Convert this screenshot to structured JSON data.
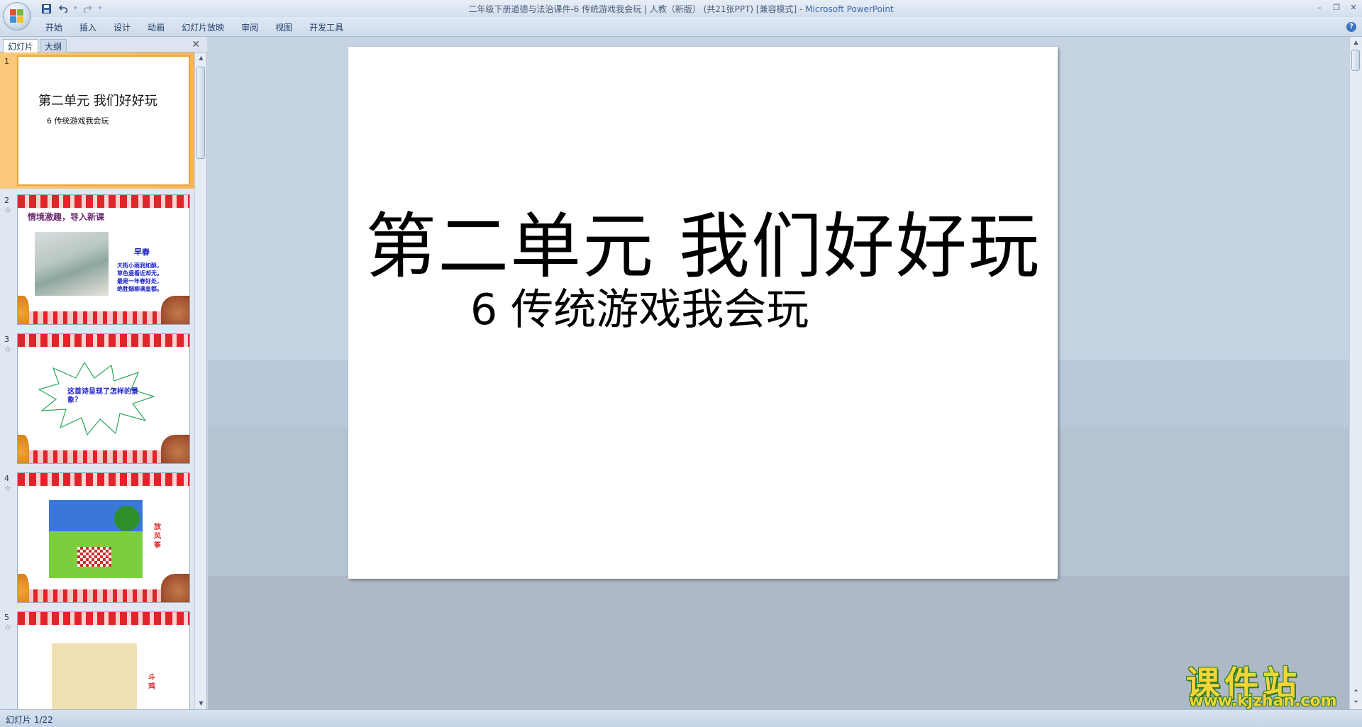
{
  "window": {
    "title_prefix": "二年级下册道德与法治课件-6  传统游戏我会玩 | 人教（新版） (共21张PPT) [兼容模式] - ",
    "title_app": "Microsoft PowerPoint",
    "controls": {
      "minimize": "–",
      "restore": "❐",
      "close": "✕"
    }
  },
  "qat": {
    "save_icon": "save-icon",
    "undo_icon": "undo-icon",
    "redo_icon": "redo-icon",
    "customize_icon": "customize-icon"
  },
  "ribbon": {
    "tabs": [
      {
        "label": "开始"
      },
      {
        "label": "插入"
      },
      {
        "label": "设计"
      },
      {
        "label": "动画"
      },
      {
        "label": "幻灯片放映"
      },
      {
        "label": "审阅"
      },
      {
        "label": "视图"
      },
      {
        "label": "开发工具"
      }
    ],
    "help": "?"
  },
  "left_panel": {
    "tabs": [
      {
        "label": "幻灯片"
      },
      {
        "label": "大纲"
      }
    ],
    "close": "✕",
    "slides": [
      {
        "num": "1",
        "title": "第二单元  我们好好玩",
        "subtitle": "6  传统游戏我会玩"
      },
      {
        "num": "2",
        "star": "☆",
        "title": "情境激趣，导入新课",
        "poem_title": "早春",
        "poem_lines": [
          "天街小雨润如酥，",
          "草色遥看近却无。",
          "最是一年春好处，",
          "绝胜烟柳满皇都。"
        ]
      },
      {
        "num": "3",
        "star": "☆",
        "question": "这首诗呈现了怎样的景象？"
      },
      {
        "num": "4",
        "star": "☆",
        "label": "放风筝"
      },
      {
        "num": "5",
        "star": "☆",
        "label": "斗鸡"
      }
    ]
  },
  "main_slide": {
    "title": "第二单元  我们好好玩",
    "subtitle": "6  传统游戏我会玩"
  },
  "status": {
    "slide_info": "幻灯片 1/22"
  },
  "watermark": {
    "cn": "课件站",
    "en": "www.kjzhan.com"
  },
  "colors": {
    "accent": "#3a68b0",
    "selected_thumb": "#f7b65a",
    "poem_blue": "#1c22c8",
    "deco_red": "#e0242a"
  }
}
